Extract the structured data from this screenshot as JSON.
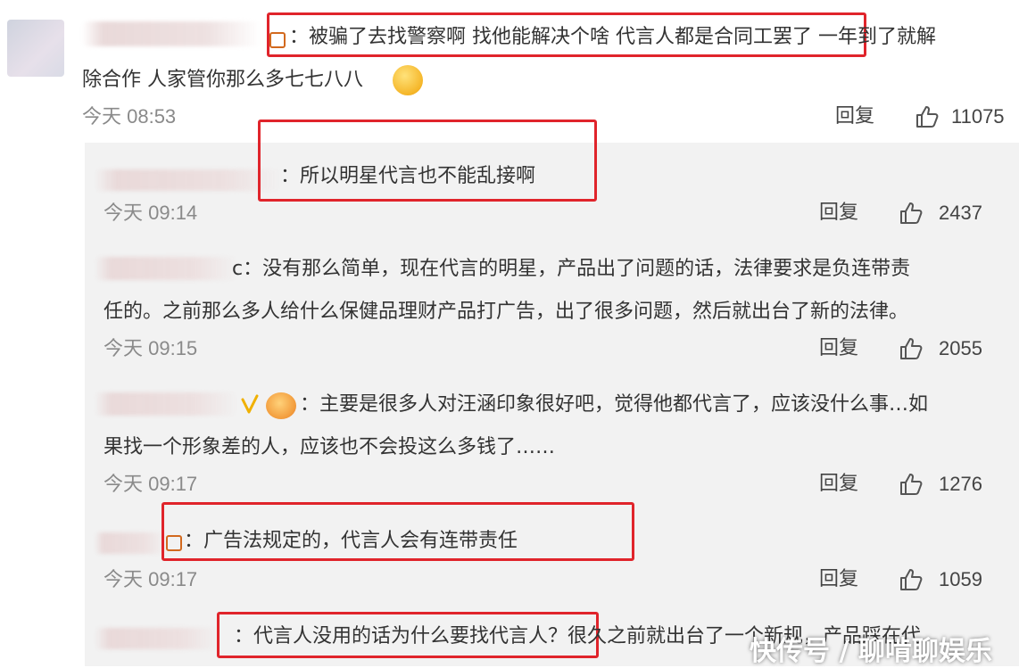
{
  "comment_main": {
    "line1": "：被骗了去找警察啊  找他能解决个啥 代言人都是合同工罢了  一年到了就解",
    "line2": "除合作  人家管你那么多七七八八",
    "time": "今天 08:53",
    "reply_label": "回复",
    "likes": "11075"
  },
  "replies": [
    {
      "text": "：所以明星代言也不能乱接啊",
      "time": "今天 09:14",
      "reply_label": "回复",
      "likes": "2437"
    },
    {
      "line1": "c：没有那么简单，现在代言的明星，产品出了问题的话，法律要求是负连带责",
      "line2": "任的。之前那么多人给什么保健品理财产品打广告，出了很多问题，然后就出台了新的法律。",
      "time": "今天 09:15",
      "reply_label": "回复",
      "likes": "2055"
    },
    {
      "line1": "：主要是很多人对汪涵印象很好吧，觉得他都代言了，应该没什么事…如",
      "line2": "果找一个形象差的人，应该也不会投这么多钱了……",
      "time": "今天 09:17",
      "reply_label": "回复",
      "likes": "1276"
    },
    {
      "text": "：广告法规定的，代言人会有连带责任",
      "time": "今天 09:17",
      "reply_label": "回复",
      "likes": "1059"
    },
    {
      "text": "：代言人没用的话为什么要找代言人？很久之前就出台了一个新规，产品踩在代"
    }
  ],
  "watermark": "快传号 / 聊啃聊娱乐",
  "colors": {
    "highlight": "#e0242b",
    "panel": "#f2f2f2",
    "time": "#8a8a8a"
  },
  "icons": [
    "avatar",
    "vip-badge-icon",
    "emoji-icon",
    "thumbs-up-icon"
  ]
}
